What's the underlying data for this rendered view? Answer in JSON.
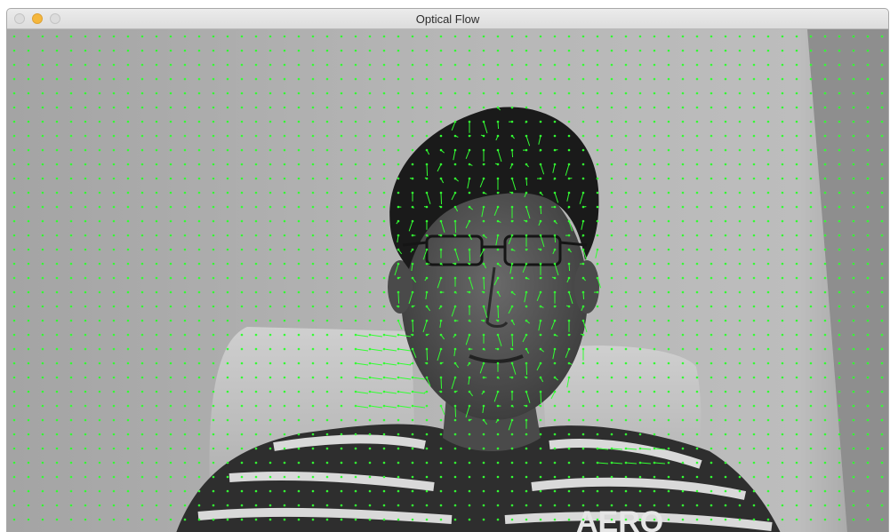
{
  "window": {
    "title": "Optical Flow",
    "controls": {
      "close_icon": "close-icon",
      "minimize_icon": "minimize-icon",
      "zoom_icon": "zoom-icon"
    }
  },
  "frame": {
    "description_mode": "grayscale",
    "flow_color": "#33ff33",
    "shirt_text": "AERO"
  }
}
